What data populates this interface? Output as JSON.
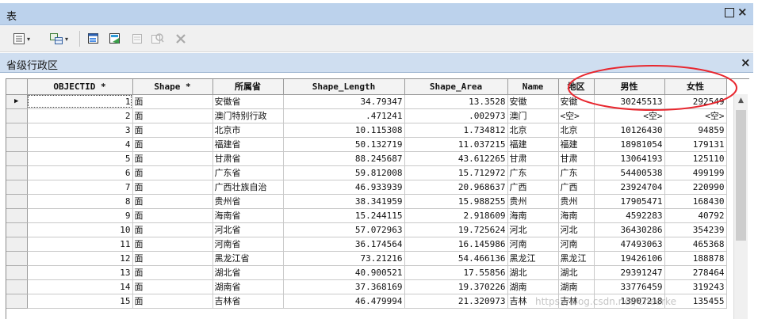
{
  "window": {
    "title": "表",
    "max_glyph": "□",
    "close_glyph": "×"
  },
  "toolbar": {
    "icons": [
      {
        "name": "table-options-icon",
        "dropdown": true
      },
      {
        "name": "related-tables-icon",
        "dropdown": true
      },
      {
        "name": "select-by-attributes-icon",
        "dropdown": false
      },
      {
        "name": "switch-selection-icon",
        "dropdown": false
      },
      {
        "name": "clear-selection-icon",
        "dropdown": false
      },
      {
        "name": "zoom-to-selected-icon",
        "dropdown": false
      },
      {
        "name": "delete-selected-icon",
        "dropdown": false
      }
    ],
    "dropdown_glyph": "▾"
  },
  "tab": {
    "title": "省级行政区",
    "close_glyph": "×"
  },
  "table": {
    "columns": [
      {
        "key": "sel",
        "label": "",
        "width": 26
      },
      {
        "key": "objectid",
        "label": "OBJECTID *",
        "width": 133
      },
      {
        "key": "shape",
        "label": "Shape *",
        "width": 101
      },
      {
        "key": "province",
        "label": "所属省",
        "width": 89
      },
      {
        "key": "shape_length",
        "label": "Shape_Length",
        "width": 153
      },
      {
        "key": "shape_area",
        "label": "Shape_Area",
        "width": 130
      },
      {
        "key": "name",
        "label": "Name",
        "width": 64
      },
      {
        "key": "region",
        "label": "地区",
        "width": 45
      },
      {
        "key": "male",
        "label": "男性",
        "width": 89
      },
      {
        "key": "female",
        "label": "女性",
        "width": 78
      }
    ],
    "current_row_marker": "▶",
    "rows": [
      {
        "objectid": "1",
        "shape": "面",
        "province": "安徽省",
        "shape_length": "34.79347",
        "shape_area": "13.3528",
        "name": "安徽",
        "region": "安徽",
        "male": "30245513",
        "female": "292549"
      },
      {
        "objectid": "2",
        "shape": "面",
        "province": "澳门特别行政",
        "shape_length": ".471241",
        "shape_area": ".002973",
        "name": "澳门",
        "region": "<空>",
        "male": "<空>",
        "female": "<空>"
      },
      {
        "objectid": "3",
        "shape": "面",
        "province": "北京市",
        "shape_length": "10.115308",
        "shape_area": "1.734812",
        "name": "北京",
        "region": "北京",
        "male": "10126430",
        "female": "94859"
      },
      {
        "objectid": "4",
        "shape": "面",
        "province": "福建省",
        "shape_length": "50.132719",
        "shape_area": "11.037215",
        "name": "福建",
        "region": "福建",
        "male": "18981054",
        "female": "179131"
      },
      {
        "objectid": "5",
        "shape": "面",
        "province": "甘肃省",
        "shape_length": "88.245687",
        "shape_area": "43.612265",
        "name": "甘肃",
        "region": "甘肃",
        "male": "13064193",
        "female": "125110"
      },
      {
        "objectid": "6",
        "shape": "面",
        "province": "广东省",
        "shape_length": "59.812008",
        "shape_area": "15.712972",
        "name": "广东",
        "region": "广东",
        "male": "54400538",
        "female": "499199"
      },
      {
        "objectid": "7",
        "shape": "面",
        "province": "广西壮族自治",
        "shape_length": "46.933939",
        "shape_area": "20.968637",
        "name": "广西",
        "region": "广西",
        "male": "23924704",
        "female": "220990"
      },
      {
        "objectid": "8",
        "shape": "面",
        "province": "贵州省",
        "shape_length": "38.341959",
        "shape_area": "15.988255",
        "name": "贵州",
        "region": "贵州",
        "male": "17905471",
        "female": "168430"
      },
      {
        "objectid": "9",
        "shape": "面",
        "province": "海南省",
        "shape_length": "15.244115",
        "shape_area": "2.918609",
        "name": "海南",
        "region": "海南",
        "male": "4592283",
        "female": "40792"
      },
      {
        "objectid": "10",
        "shape": "面",
        "province": "河北省",
        "shape_length": "57.072963",
        "shape_area": "19.725624",
        "name": "河北",
        "region": "河北",
        "male": "36430286",
        "female": "354239"
      },
      {
        "objectid": "11",
        "shape": "面",
        "province": "河南省",
        "shape_length": "36.174564",
        "shape_area": "16.145986",
        "name": "河南",
        "region": "河南",
        "male": "47493063",
        "female": "465368"
      },
      {
        "objectid": "12",
        "shape": "面",
        "province": "黑龙江省",
        "shape_length": "73.21216",
        "shape_area": "54.466136",
        "name": "黑龙江",
        "region": "黑龙江",
        "male": "19426106",
        "female": "188878"
      },
      {
        "objectid": "13",
        "shape": "面",
        "province": "湖北省",
        "shape_length": "40.900521",
        "shape_area": "17.55856",
        "name": "湖北",
        "region": "湖北",
        "male": "29391247",
        "female": "278464"
      },
      {
        "objectid": "14",
        "shape": "面",
        "province": "湖南省",
        "shape_length": "37.368169",
        "shape_area": "19.370226",
        "name": "湖南",
        "region": "湖南",
        "male": "33776459",
        "female": "319243"
      },
      {
        "objectid": "15",
        "shape": "面",
        "province": "吉林省",
        "shape_length": "46.479994",
        "shape_area": "21.320973",
        "name": "吉林",
        "region": "吉林",
        "male": "13907218",
        "female": "135455"
      }
    ]
  },
  "scrollbar": {
    "up_glyph": "▲"
  },
  "annotation": {
    "color": "#e8262e"
  },
  "watermark": "https://blog.csdn.net/Cheerke"
}
